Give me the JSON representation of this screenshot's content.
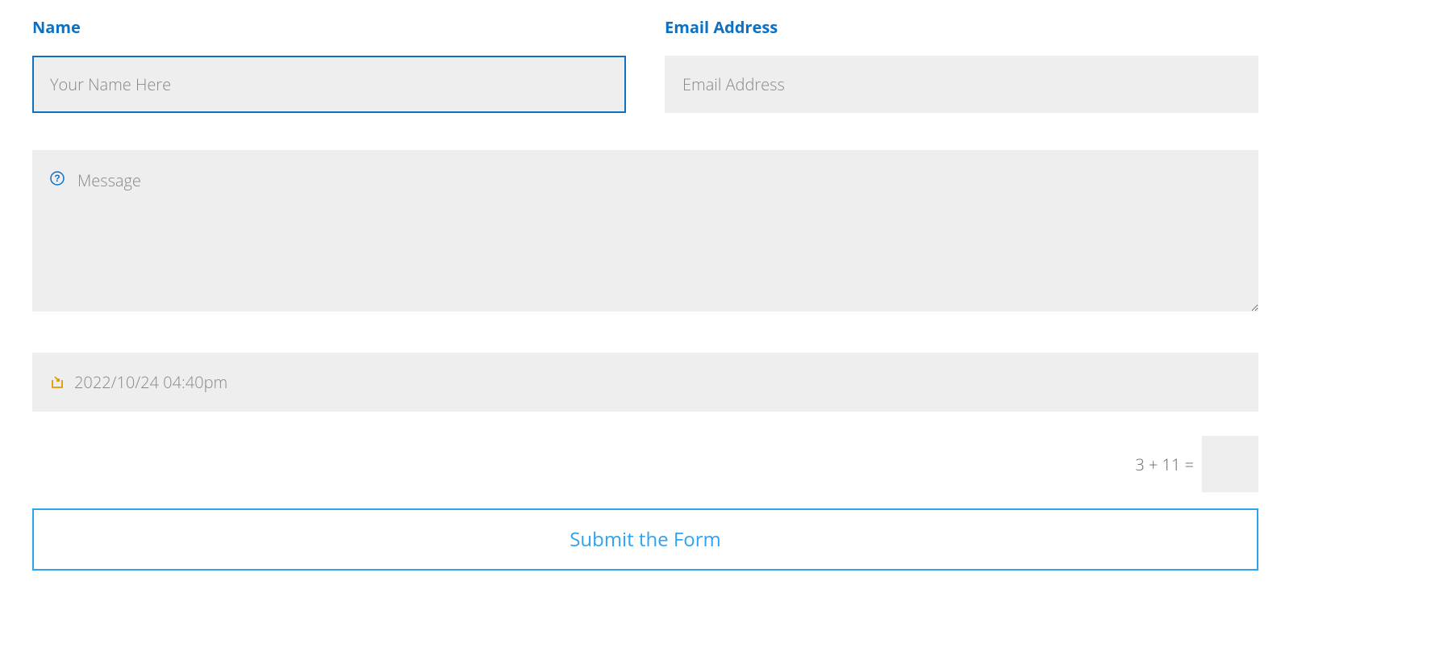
{
  "form": {
    "name": {
      "label": "Name",
      "placeholder": "Your Name Here",
      "value": ""
    },
    "email": {
      "label": "Email Address",
      "placeholder": "Email Address",
      "value": ""
    },
    "message": {
      "placeholder": "Message",
      "value": ""
    },
    "datetime": {
      "value": "2022/10/24 04:40pm"
    },
    "captcha": {
      "label": "3 + 11 =",
      "value": ""
    },
    "submit": {
      "label": "Submit the Form"
    }
  }
}
